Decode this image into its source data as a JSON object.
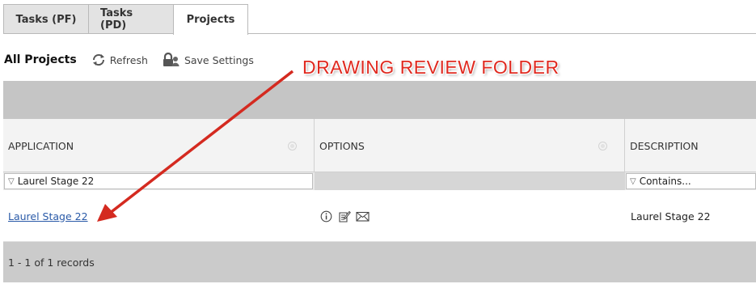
{
  "tabs": [
    {
      "label": "Tasks (PF)"
    },
    {
      "label": "Tasks (PD)"
    },
    {
      "label": "Projects"
    }
  ],
  "toolbar": {
    "title": "All Projects",
    "refresh_label": "Refresh",
    "save_settings_label": "Save Settings"
  },
  "annotation": {
    "text": "DRAWING REVIEW FOLDER",
    "color": "#e02a20"
  },
  "grid": {
    "columns": [
      "APPLICATION",
      "OPTIONS",
      "DESCRIPTION"
    ],
    "filters": {
      "application": "Laurel Stage 22",
      "description_placeholder": "Contains..."
    },
    "rows": [
      {
        "application": "Laurel Stage 22",
        "description": "Laurel Stage 22"
      }
    ],
    "footer": "1 - 1 of 1 records"
  },
  "icons": [
    "refresh-icon",
    "save-settings-icon",
    "gear-icon",
    "filter-icon",
    "info-icon",
    "edit-icon",
    "mail-icon"
  ]
}
